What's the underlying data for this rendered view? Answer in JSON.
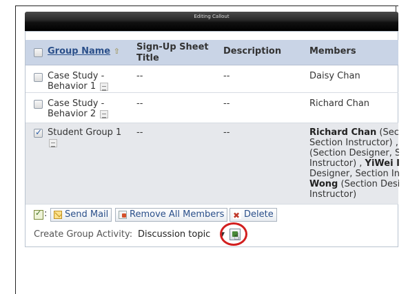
{
  "window": {
    "title": "Editing Callout"
  },
  "table": {
    "headers": {
      "group_name": "Group Name",
      "signup_title": "Sign-Up Sheet Title",
      "description": "Description",
      "members": "Members"
    },
    "rows": [
      {
        "name": "Case Study - Behavior 1",
        "signup": "--",
        "description": "--",
        "members_lines": [
          "Daisy Chan"
        ],
        "checked": false
      },
      {
        "name": "Case Study - Behavior 2",
        "signup": "--",
        "description": "--",
        "members_lines": [
          "Richard Chan"
        ],
        "checked": false
      },
      {
        "name": "Student Group 1",
        "signup": "--",
        "description": "--",
        "checked": true,
        "members_rich": [
          {
            "bold": "Richard Chan",
            "rest": " (Sect"
          },
          {
            "bold": "",
            "rest": "Section Instructor) ,"
          },
          {
            "bold": "",
            "rest": "(Section Designer, S"
          },
          {
            "bold": "YiWei I",
            "pre": "Instructor) , ",
            "rest": ""
          },
          {
            "bold": "",
            "rest": "Designer, Section In"
          },
          {
            "bold": "Wong",
            "rest": " (Section Desi"
          },
          {
            "bold": "",
            "rest": "Instructor)"
          }
        ]
      }
    ]
  },
  "actions": {
    "send_mail": "Send Mail",
    "remove_all": "Remove All Members",
    "delete": "Delete",
    "colon": ":"
  },
  "activity": {
    "label": "Create Group Activity:",
    "selected": "Discussion topic"
  },
  "icons": {
    "sort": "sort-ascending-icon",
    "download": "download-icon",
    "go": "go-icon",
    "cursor": "hand-cursor-icon"
  },
  "colors": {
    "header_bg": "#c9d4e6",
    "link": "#2a4f8a",
    "highlight_circle": "#d21f1f"
  }
}
